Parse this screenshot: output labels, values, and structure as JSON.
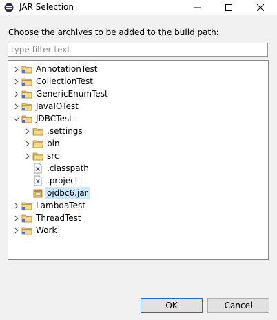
{
  "window": {
    "title": "JAR Selection"
  },
  "dialog": {
    "instruction": "Choose the archives to be added to the build path:",
    "filter_placeholder": "type filter text",
    "filter_value": ""
  },
  "tree": [
    {
      "label": "AnnotationTest",
      "kind": "project",
      "expanded": false,
      "depth": 0
    },
    {
      "label": "CollectionTest",
      "kind": "project",
      "expanded": false,
      "depth": 0
    },
    {
      "label": "GenericEnumTest",
      "kind": "project",
      "expanded": false,
      "depth": 0
    },
    {
      "label": "JavaIOTest",
      "kind": "project",
      "expanded": false,
      "depth": 0
    },
    {
      "label": "JDBCTest",
      "kind": "project",
      "expanded": true,
      "depth": 0
    },
    {
      "label": ".settings",
      "kind": "folder",
      "expanded": false,
      "depth": 1
    },
    {
      "label": "bin",
      "kind": "folder",
      "expanded": false,
      "depth": 1
    },
    {
      "label": "src",
      "kind": "folder",
      "expanded": false,
      "depth": 1
    },
    {
      "label": ".classpath",
      "kind": "xmlfile",
      "depth": 1
    },
    {
      "label": ".project",
      "kind": "xmlfile",
      "depth": 1
    },
    {
      "label": "ojdbc6.jar",
      "kind": "jar",
      "depth": 1,
      "selected": true
    },
    {
      "label": "LambdaTest",
      "kind": "project",
      "expanded": false,
      "depth": 0
    },
    {
      "label": "ThreadTest",
      "kind": "project",
      "expanded": false,
      "depth": 0
    },
    {
      "label": "Work",
      "kind": "project",
      "expanded": false,
      "depth": 0
    }
  ],
  "buttons": {
    "ok": "OK",
    "cancel": "Cancel"
  }
}
